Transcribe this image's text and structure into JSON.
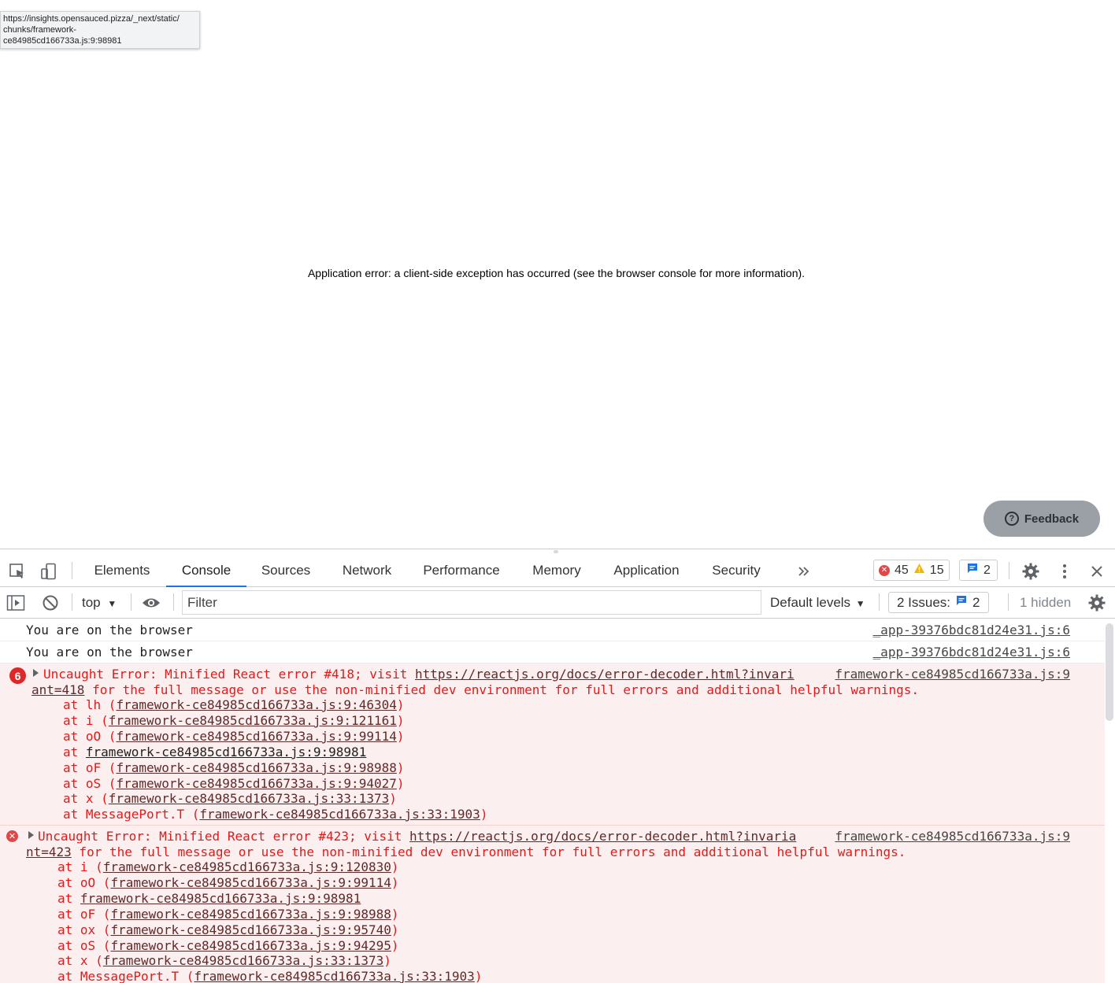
{
  "page": {
    "tooltip": [
      "https://insights.opensauced.pizza/_next/static/",
      "chunks/framework-",
      "ce84985cd166733a.js:9:98981"
    ],
    "app_error": "Application error: a client-side exception has occurred (see the browser console for more information).",
    "feedback_label": "Feedback"
  },
  "devtools": {
    "tabs": [
      "Elements",
      "Console",
      "Sources",
      "Network",
      "Performance",
      "Memory",
      "Application",
      "Security"
    ],
    "active_tab": "Console",
    "error_count": "45",
    "warning_count": "15",
    "message_count": "2",
    "context": "top",
    "filter_placeholder": "Filter",
    "levels": "Default levels",
    "issues_label": "2 Issues:",
    "issues_count": "2",
    "hidden_label": "1 hidden",
    "colors": {
      "accent": "#1a73e8",
      "error": "#e41919",
      "error_bg": "#fcefef"
    }
  },
  "console": {
    "logs": [
      {
        "text": "You are on the browser",
        "source": "_app-39376bdc81d24e31.js:6"
      },
      {
        "text": "You are on the browser",
        "source": "_app-39376bdc81d24e31.js:6"
      }
    ],
    "errors": [
      {
        "repeat": "6",
        "prefix": "Uncaught Error: Minified React error #418; visit ",
        "url1": "https://reactjs.org/docs/error-decoder.html?invari",
        "url2": "ant=418",
        "rest": " for the full message or use the non-minified dev environment for full errors and additional helpful warnings.",
        "source": "framework-ce84985cd166733a.js:9",
        "stack": [
          {
            "pre": "at lh (",
            "link": "framework-ce84985cd166733a.js:9:46304",
            "post": ")"
          },
          {
            "pre": "at i (",
            "link": "framework-ce84985cd166733a.js:9:121161",
            "post": ")"
          },
          {
            "pre": "at oO (",
            "link": "framework-ce84985cd166733a.js:9:99114",
            "post": ")"
          },
          {
            "pre": "at ",
            "link": "framework-ce84985cd166733a.js:9:98981",
            "post": ""
          },
          {
            "pre": "at oF (",
            "link": "framework-ce84985cd166733a.js:9:98988",
            "post": ")"
          },
          {
            "pre": "at oS (",
            "link": "framework-ce84985cd166733a.js:9:94027",
            "post": ")"
          },
          {
            "pre": "at x (",
            "link": "framework-ce84985cd166733a.js:33:1373",
            "post": ")"
          },
          {
            "pre": "at MessagePort.T (",
            "link": "framework-ce84985cd166733a.js:33:1903",
            "post": ")"
          }
        ]
      },
      {
        "prefix": "Uncaught Error: Minified React error #423; visit ",
        "url1": "https://reactjs.org/docs/error-decoder.html?invaria",
        "url2": "nt=423",
        "rest": " for the full message or use the non-minified dev environment for full errors and additional helpful warnings.",
        "source": "framework-ce84985cd166733a.js:9",
        "stack": [
          {
            "pre": "at i (",
            "link": "framework-ce84985cd166733a.js:9:120830",
            "post": ")"
          },
          {
            "pre": "at oO (",
            "link": "framework-ce84985cd166733a.js:9:99114",
            "post": ")"
          },
          {
            "pre": "at ",
            "link": "framework-ce84985cd166733a.js:9:98981",
            "post": ""
          },
          {
            "pre": "at oF (",
            "link": "framework-ce84985cd166733a.js:9:98988",
            "post": ")"
          },
          {
            "pre": "at ox (",
            "link": "framework-ce84985cd166733a.js:9:95740",
            "post": ")"
          },
          {
            "pre": "at oS (",
            "link": "framework-ce84985cd166733a.js:9:94295",
            "post": ")"
          },
          {
            "pre": "at x (",
            "link": "framework-ce84985cd166733a.js:33:1373",
            "post": ")"
          },
          {
            "pre": "at MessagePort.T (",
            "link": "framework-ce84985cd166733a.js:33:1903",
            "post": ")"
          }
        ]
      }
    ]
  }
}
